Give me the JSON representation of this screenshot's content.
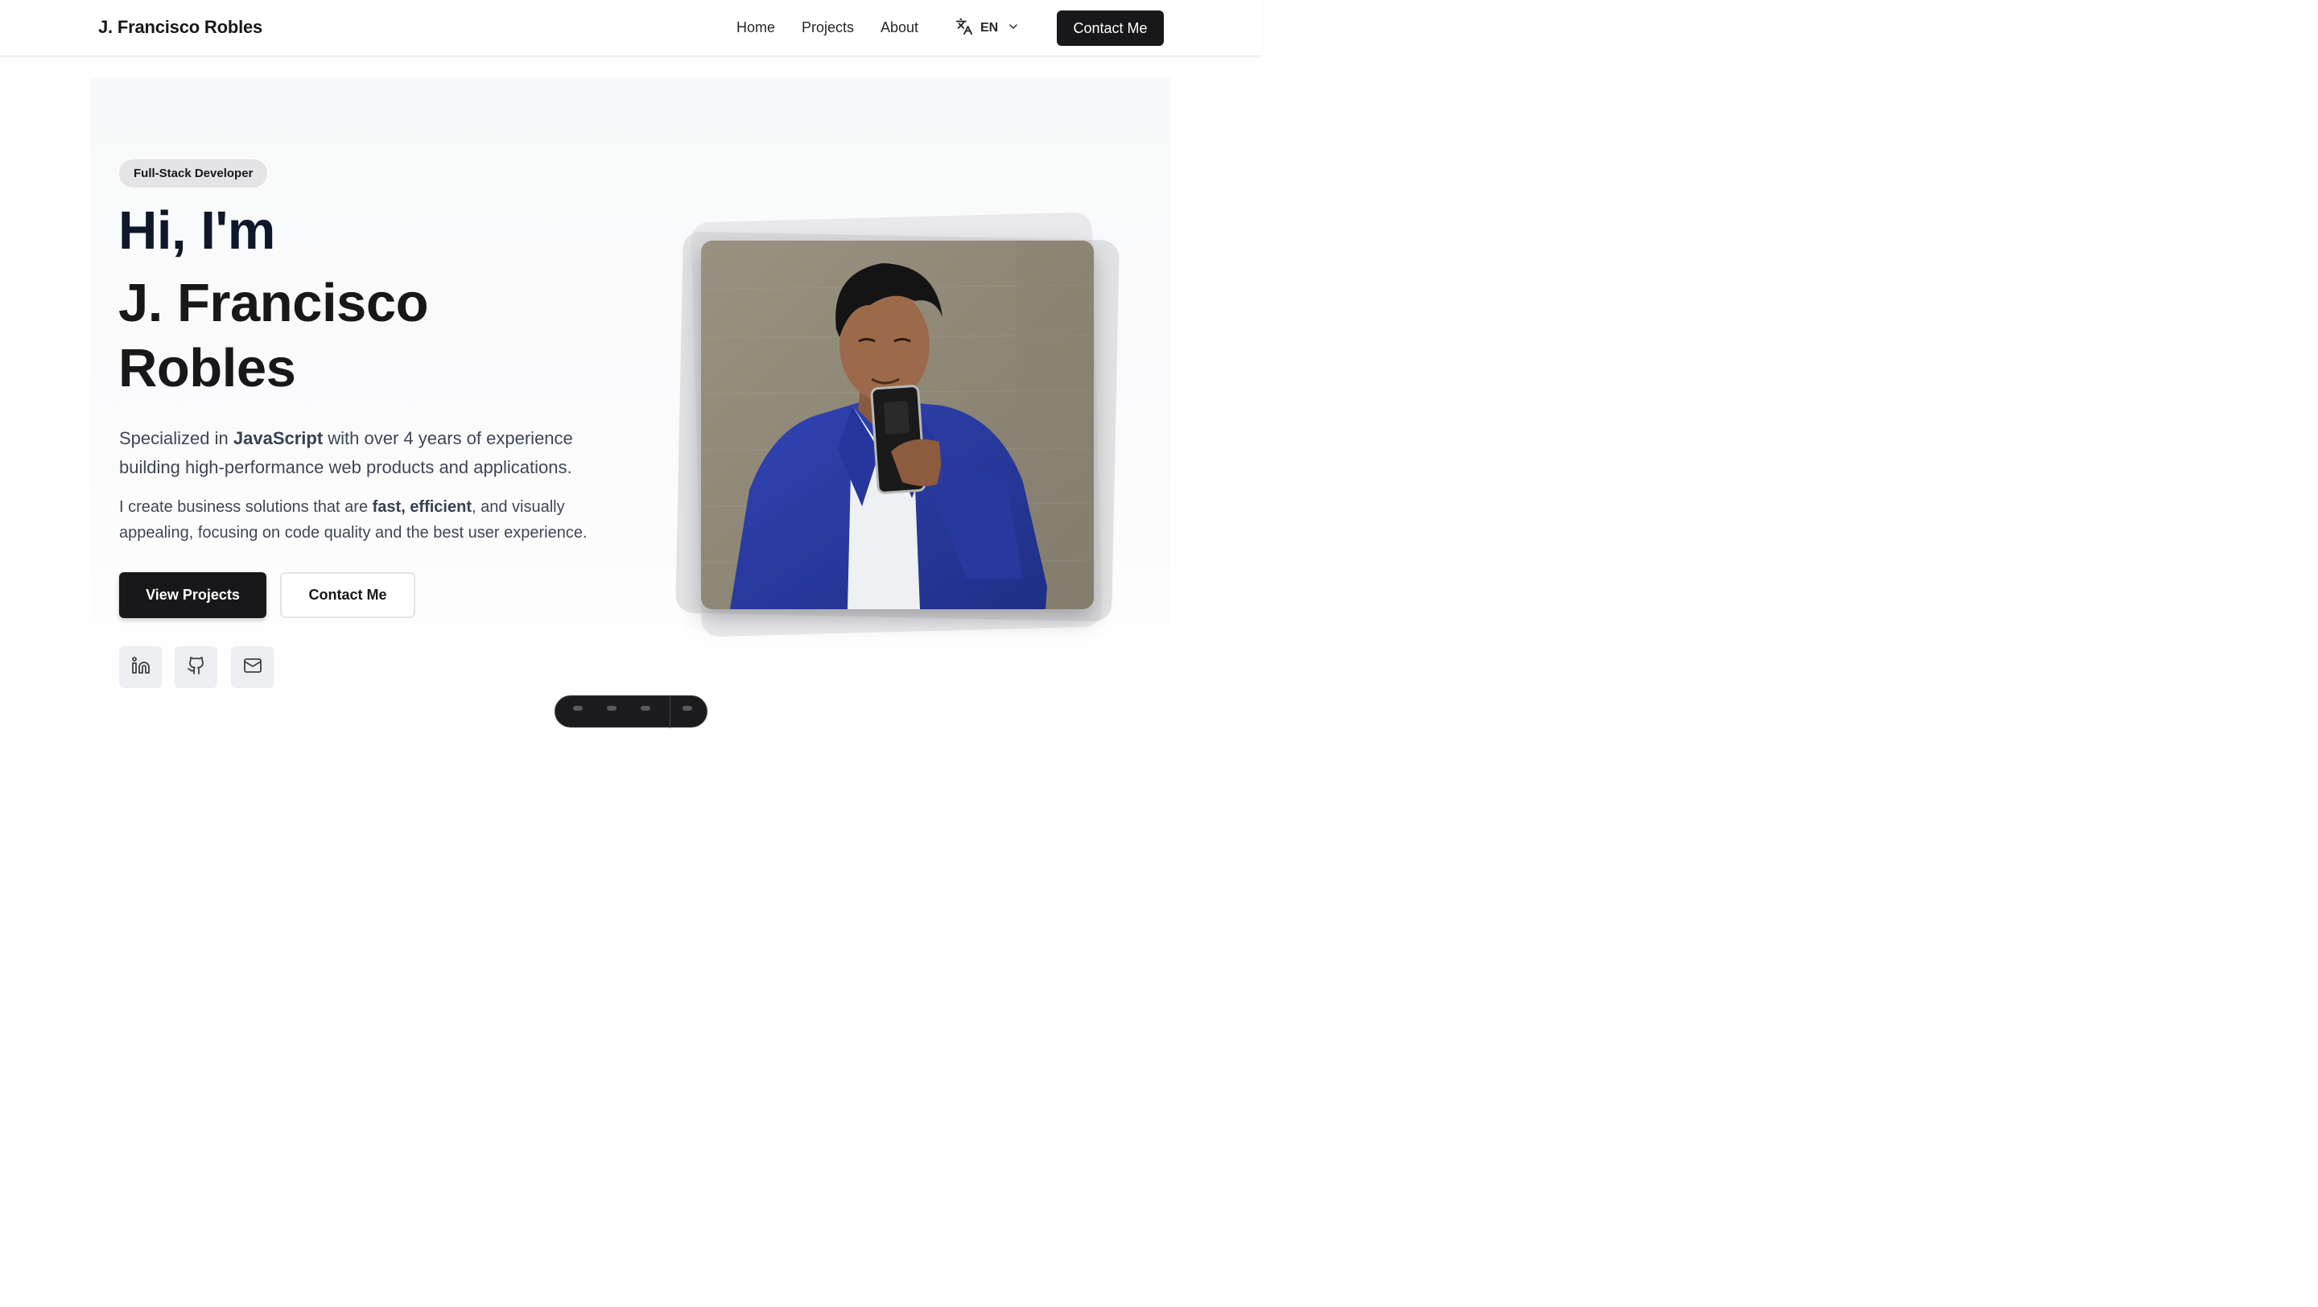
{
  "header": {
    "brand": "J. Francisco Robles",
    "nav": [
      {
        "label": "Home"
      },
      {
        "label": "Projects"
      },
      {
        "label": "About"
      }
    ],
    "language": {
      "icon": "translate-icon",
      "label": "EN",
      "chevron_icon": "chevron-down-icon"
    },
    "cta_label": "Contact Me"
  },
  "hero": {
    "badge": "Full-Stack Developer",
    "greeting": "Hi, I'm",
    "name_line1": "J. Francisco",
    "name_line2": "Robles",
    "lead": {
      "pre": "Specialized in ",
      "strong": "JavaScript",
      "post": " with over 4 years of experience building high-performance web products and applications."
    },
    "secondary": {
      "pre": "I create business solutions that are ",
      "strong": "fast, efficient",
      "post": ", and visually appealing, focusing on code quality and the best user experience."
    },
    "primary_button": "View Projects",
    "secondary_button": "Contact Me",
    "social": [
      {
        "icon": "linkedin-icon"
      },
      {
        "icon": "github-icon"
      },
      {
        "icon": "mail-icon"
      }
    ],
    "photo": {
      "icon": "profile-photo"
    }
  },
  "colors": {
    "primary": "#18181b",
    "background": "#f8f9fa",
    "text_muted": "#3f4654",
    "badge_bg": "#e4e4e7",
    "jacket_blue": "#2d3fa8"
  }
}
